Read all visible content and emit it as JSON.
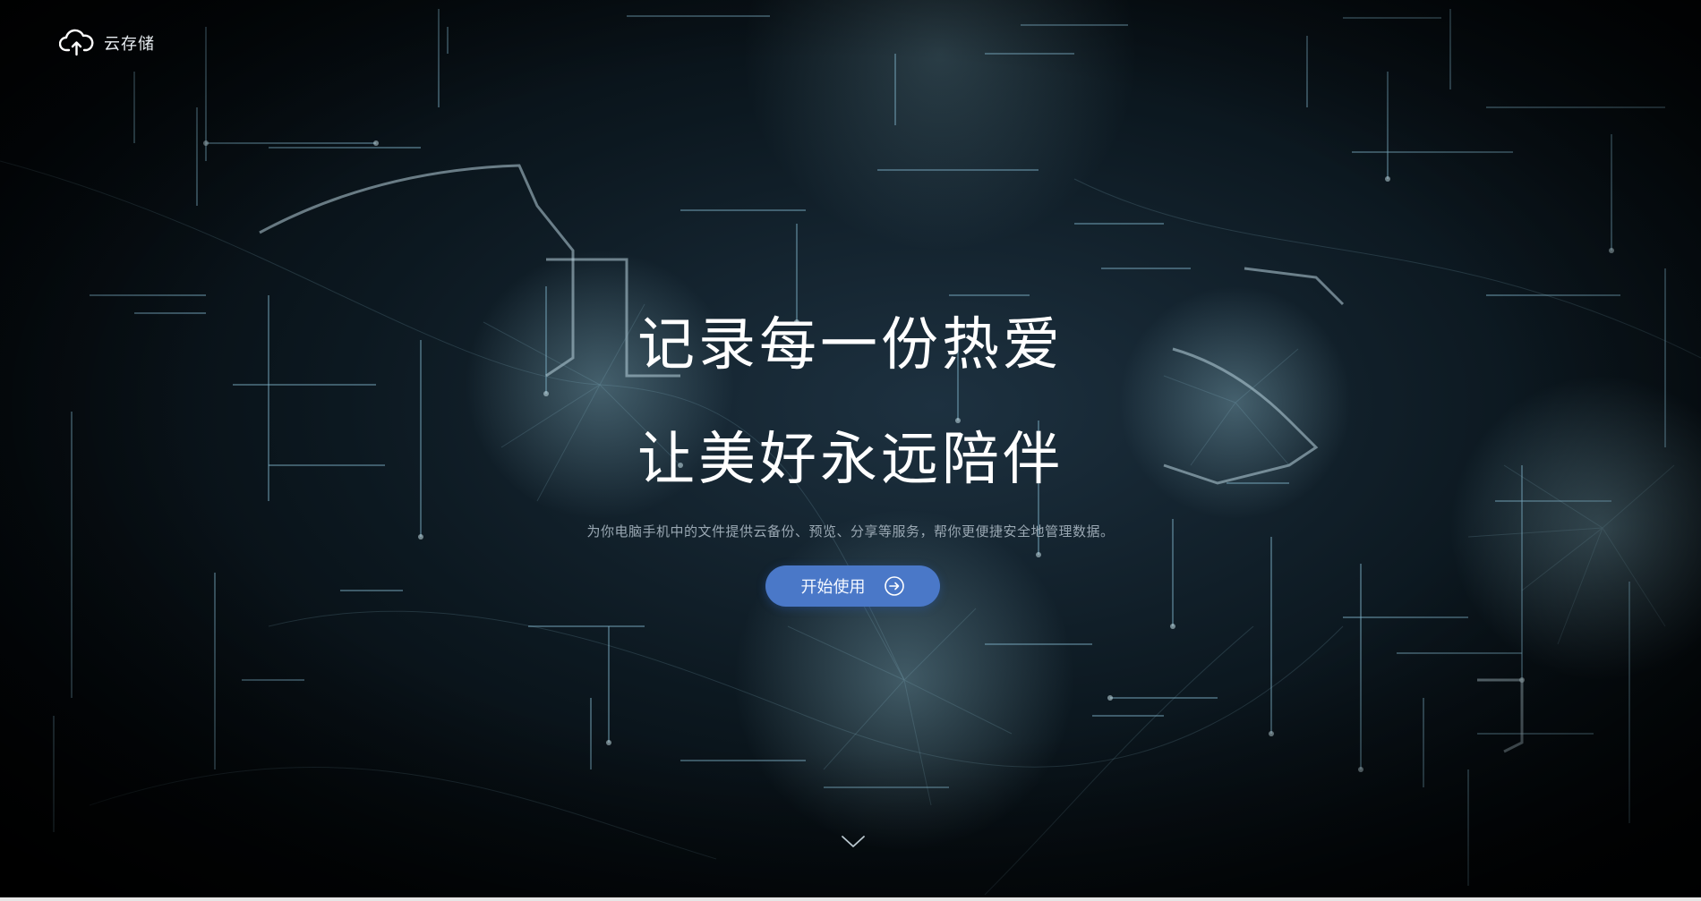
{
  "header": {
    "logo_icon": "cloud-upload-icon",
    "brand": "云存储"
  },
  "hero": {
    "title_line1": "记录每一份热爱",
    "title_line2": "让美好永远陪伴",
    "subtitle": "为你电脑手机中的文件提供云备份、预览、分享等服务，帮你更便捷安全地管理数据。",
    "cta_label": "开始使用",
    "cta_icon": "arrow-right-circle-icon",
    "scroll_icon": "chevron-down-icon"
  },
  "colors": {
    "accent": "#4a78c8",
    "text": "#ffffff",
    "subtext": "#9aa8b3",
    "line": "#7fb2c8"
  }
}
